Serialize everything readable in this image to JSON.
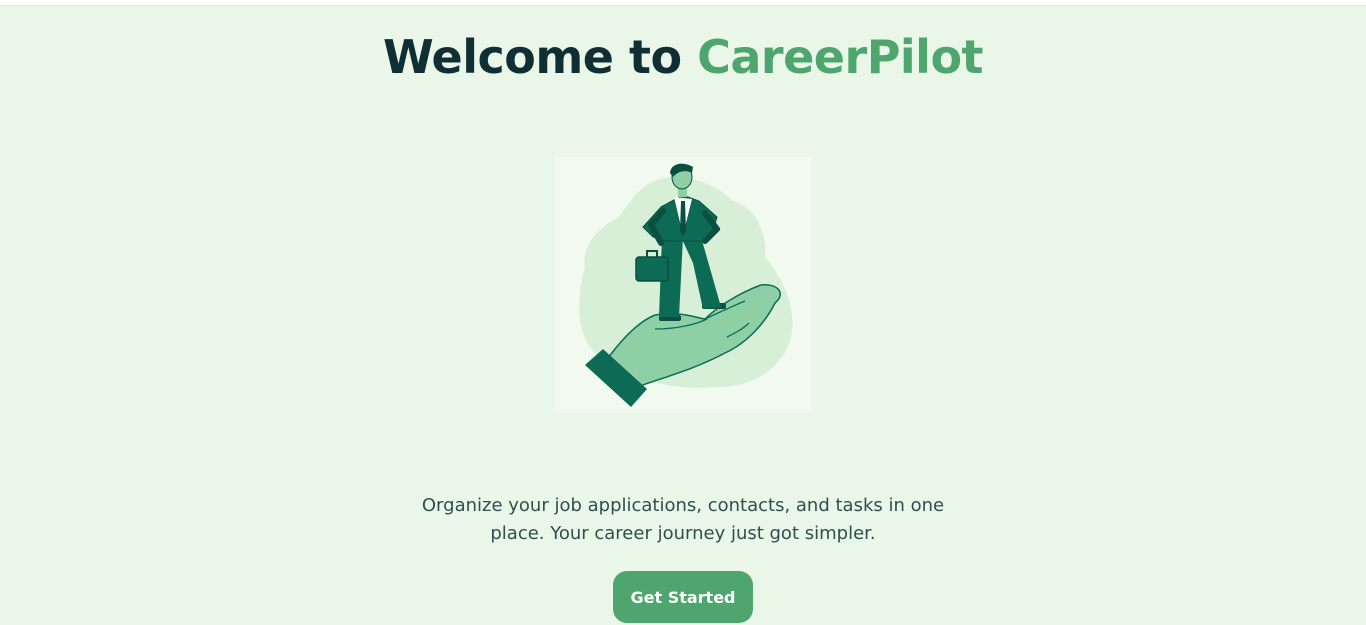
{
  "header": {
    "title_prefix": "Welcome to",
    "brand_name": "CareerPilot"
  },
  "hero": {
    "illustration_icon": "businessman-on-hand-illustration",
    "tagline_line1": "Organize your job applications, contacts, and tasks in one",
    "tagline_line2": "place. Your career journey just got simpler.",
    "cta_label": "Get Started"
  },
  "colors": {
    "background": "#eaf7e8",
    "heading": "#0f2f35",
    "brand": "#4ea56e",
    "button": "#4ea56e",
    "illustration_dark": "#0d6b55",
    "illustration_light": "#8fcfa6"
  }
}
